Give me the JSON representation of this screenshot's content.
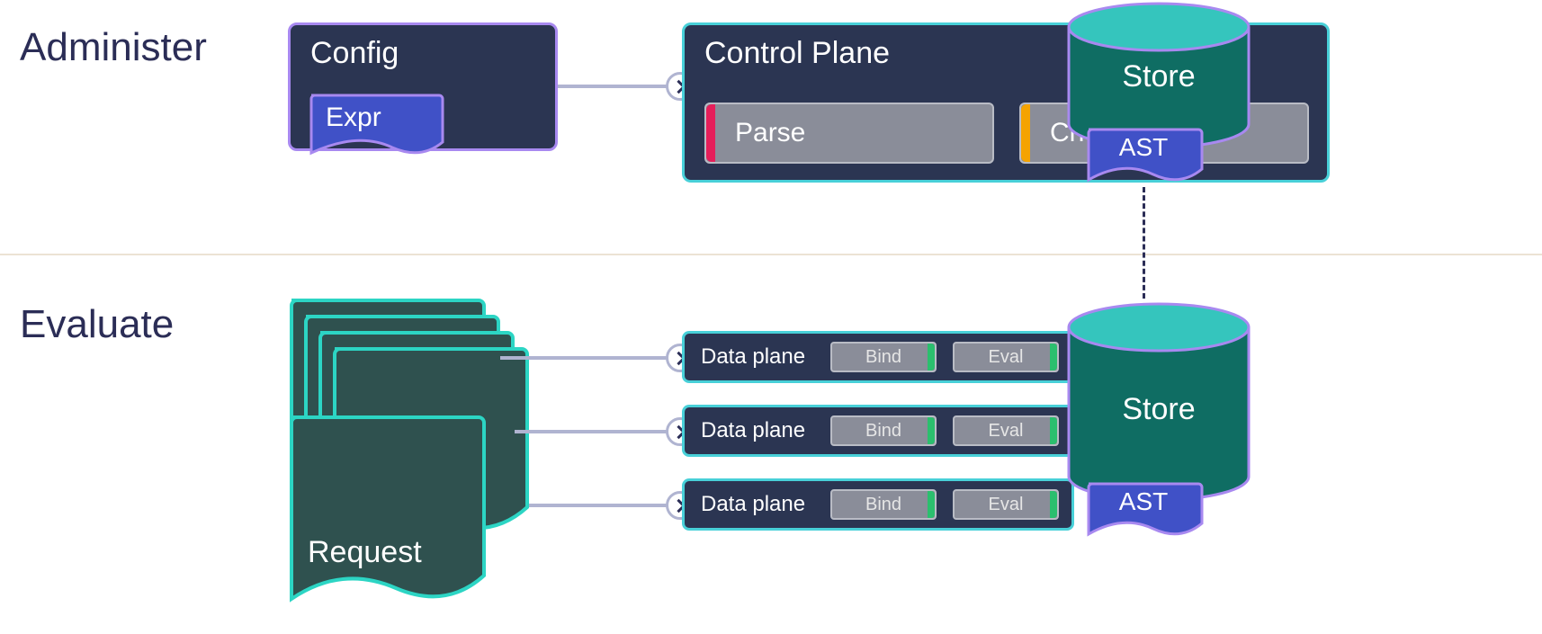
{
  "sections": {
    "administer": "Administer",
    "evaluate": "Evaluate"
  },
  "config": {
    "title": "Config",
    "expr_label": "Expr"
  },
  "control_plane": {
    "title": "Control Plane",
    "phases": {
      "parse": "Parse",
      "check": "Check"
    }
  },
  "store_top": {
    "label": "Store",
    "ast_label": "AST"
  },
  "store_bottom": {
    "label": "Store",
    "ast_label": "AST"
  },
  "request": {
    "label": "Request"
  },
  "data_plane": {
    "title": "Data plane",
    "bind": "Bind",
    "eval": "Eval"
  },
  "colors": {
    "panel_bg": "#2b3552",
    "purple_outline": "#a889f0",
    "teal_outline": "#48d0d8",
    "indigo": "#4051c7",
    "teal_dark": "#0f6d63",
    "teal_top": "#35c5bd",
    "red": "#e61e5a",
    "orange": "#f5a300",
    "green": "#2bbf6e",
    "connector": "#b0b4d1",
    "label": "#2b2d56"
  }
}
